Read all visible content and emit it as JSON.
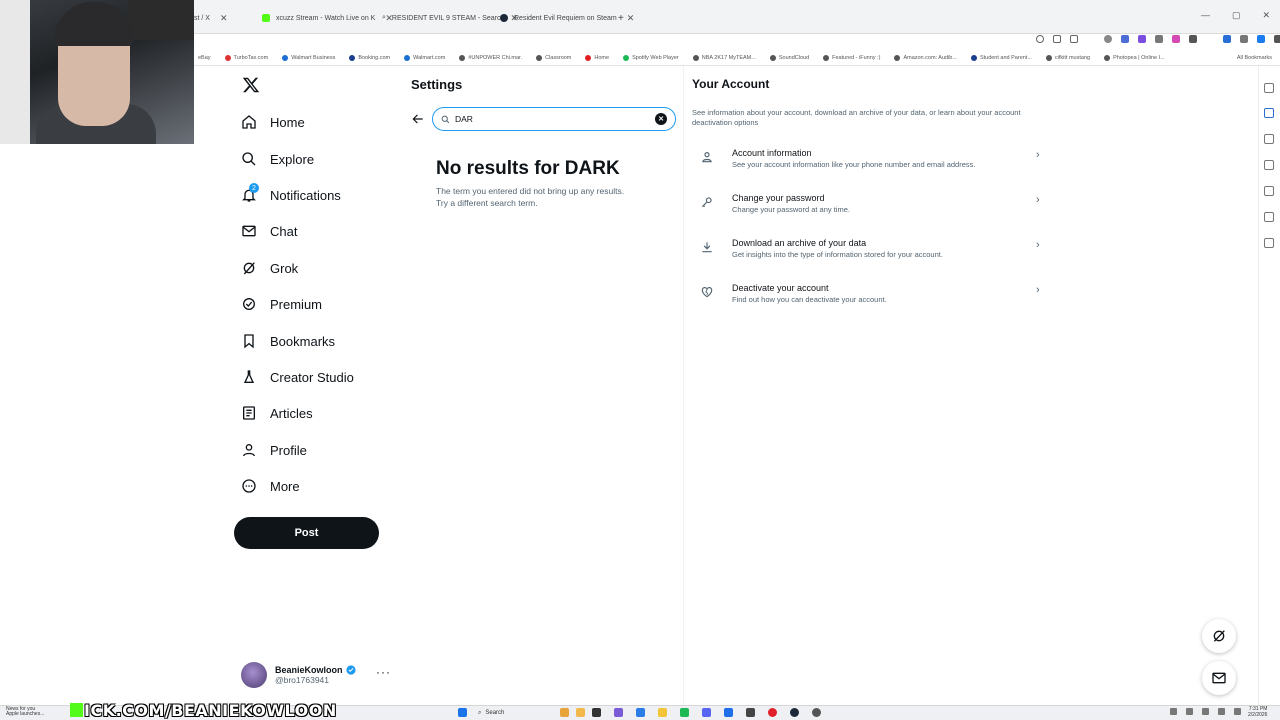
{
  "browser": {
    "tabs": [
      {
        "label": "st / X",
        "active": true
      },
      {
        "label": "xcuzz Stream - Watch Live on K",
        "active": false
      },
      {
        "label": "RESIDENT EVIL 9 STEAM - Searc",
        "active": false
      },
      {
        "label": "Resident Evil Requiem on Steam",
        "active": false
      }
    ],
    "new_tab": "+",
    "bookmarks": [
      "eBay",
      "TurboTax.com",
      "Walmart Business",
      "Booking.com",
      "Walmart.com",
      "#UNPOWER Chi.mar.",
      "Classroom",
      "Home",
      "Spotify Web Player",
      "NBA 2K17 MyTEAM...",
      "SoundCloud",
      "Featured - iFunny :)",
      "Amazon.com: Audib...",
      "Student and Parent...",
      "cifkitt mustang",
      "Photopea | Online I..."
    ],
    "all_bookmarks": "All Bookmarks"
  },
  "nav": {
    "logo": "X",
    "items": [
      {
        "label": "Home",
        "icon": "home-icon"
      },
      {
        "label": "Explore",
        "icon": "search-icon"
      },
      {
        "label": "Notifications",
        "icon": "bell-icon",
        "badge": "2"
      },
      {
        "label": "Chat",
        "icon": "mail-icon"
      },
      {
        "label": "Grok",
        "icon": "grok-icon"
      },
      {
        "label": "Premium",
        "icon": "verified-icon"
      },
      {
        "label": "Bookmarks",
        "icon": "bookmark-icon"
      },
      {
        "label": "Creator Studio",
        "icon": "flask-icon"
      },
      {
        "label": "Articles",
        "icon": "article-icon"
      },
      {
        "label": "Profile",
        "icon": "person-icon"
      },
      {
        "label": "More",
        "icon": "more-circle-icon"
      }
    ],
    "post_label": "Post"
  },
  "account": {
    "name": "BeanieKowloon",
    "handle": "@bro1763941",
    "more": "···"
  },
  "settings": {
    "title": "Settings",
    "search_value": "DAR",
    "no_results_title": "No results for DARK",
    "no_results_text": "The term you entered did not bring up any results. Try a different search term."
  },
  "your_account": {
    "title": "Your Account",
    "description": "See information about your account, download an archive of your data, or learn about your account deactivation options",
    "rows": [
      {
        "title": "Account information",
        "desc": "See your account information like your phone number and email address."
      },
      {
        "title": "Change your password",
        "desc": "Change your password at any time."
      },
      {
        "title": "Download an archive of your data",
        "desc": "Get insights into the type of information stored for your account."
      },
      {
        "title": "Deactivate your account",
        "desc": "Find out how you can deactivate your account."
      }
    ]
  },
  "overlay": {
    "kick_url": "ICK.COM/BEANIEKOWLOON",
    "news": "News for you",
    "news_sub": "Apple launches..."
  },
  "taskbar": {
    "search": "Search",
    "time": "7:31 PM",
    "date": "2/2/2026"
  },
  "colors": {
    "accent": "#1d9bf0",
    "text": "#0f1419",
    "muted": "#536471",
    "kick_green": "#53fc18"
  }
}
